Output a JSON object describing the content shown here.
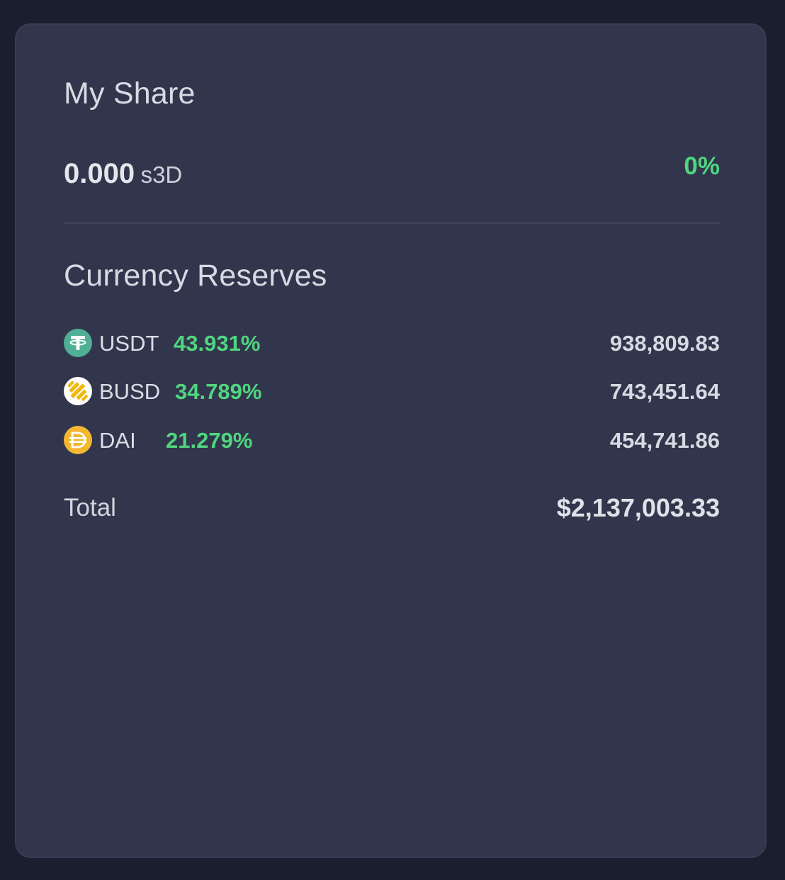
{
  "my_share": {
    "title": "My Share",
    "amount": "0.000",
    "unit": "s3D",
    "percent": "0%"
  },
  "reserves": {
    "title": "Currency Reserves",
    "items": [
      {
        "symbol": "USDT",
        "percent": "43.931%",
        "amount": "938,809.83",
        "icon": "tether-icon"
      },
      {
        "symbol": "BUSD",
        "percent": "34.789%",
        "amount": "743,451.64",
        "icon": "busd-icon"
      },
      {
        "symbol": "DAI",
        "percent": "21.279%",
        "amount": "454,741.86",
        "icon": "dai-icon"
      }
    ],
    "total_label": "Total",
    "total_value": "$2,137,003.33"
  },
  "colors": {
    "background": "#1b1e2e",
    "card": "#32364c",
    "positive": "#4fd67f",
    "tether": "#50af95",
    "busd": "#f0b90b",
    "dai": "#f4b731"
  }
}
